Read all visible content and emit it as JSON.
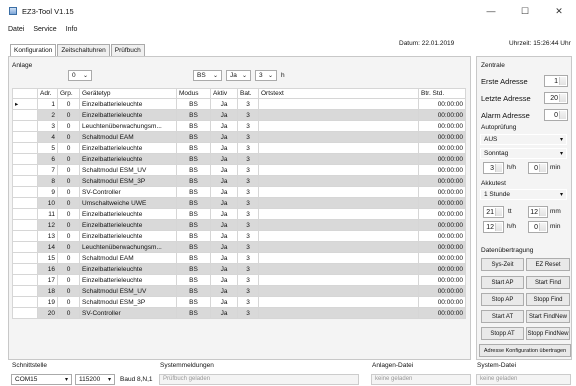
{
  "window": {
    "title": "EZ3-Tool V1.15",
    "minimize": "—",
    "maximize": "☐",
    "close": "✕"
  },
  "menu": [
    "Datei",
    "Service",
    "Info"
  ],
  "tabs": [
    "Konfiguration",
    "Zeitschaltuhren",
    "Prüfbuch"
  ],
  "date_label": "Datum: 22.01.2019",
  "time_label": "Uhrzeit: 15:26:44 Uhr",
  "anlage": {
    "label": "Anlage",
    "value": "0",
    "modus": "BS",
    "aktiv": "Ja",
    "bat": "3",
    "unit": "h"
  },
  "table": {
    "headers": [
      "",
      "Adr.",
      "Grp.",
      "Gerätetyp",
      "Modus",
      "Aktiv",
      "Bat.",
      "Ortstext",
      "Btr. Std."
    ],
    "rows": [
      [
        "▸",
        "1",
        "0",
        "Einzelbatterieleuchte",
        "BS",
        "Ja",
        "3",
        "",
        "00:00:00"
      ],
      [
        "",
        "2",
        "0",
        "Einzelbatterieleuchte",
        "BS",
        "Ja",
        "3",
        "",
        "00:00:00"
      ],
      [
        "",
        "3",
        "0",
        "Leuchtenüberwachungsm...",
        "BS",
        "Ja",
        "3",
        "",
        "00:00:00"
      ],
      [
        "",
        "4",
        "0",
        "Schaltmodul EAM",
        "BS",
        "Ja",
        "3",
        "",
        "00:00:00"
      ],
      [
        "",
        "5",
        "0",
        "Einzelbatterieleuchte",
        "BS",
        "Ja",
        "3",
        "",
        "00:00:00"
      ],
      [
        "",
        "6",
        "0",
        "Einzelbatterieleuchte",
        "BS",
        "Ja",
        "3",
        "",
        "00:00:00"
      ],
      [
        "",
        "7",
        "0",
        "Schaltmodul ESM_UV",
        "BS",
        "Ja",
        "3",
        "",
        "00:00:00"
      ],
      [
        "",
        "8",
        "0",
        "Schaltmodul ESM_3P",
        "BS",
        "Ja",
        "3",
        "",
        "00:00:00"
      ],
      [
        "",
        "9",
        "0",
        "SV-Controller",
        "BS",
        "Ja",
        "3",
        "",
        "00:00:00"
      ],
      [
        "",
        "10",
        "0",
        "Umschaltweiche UWE",
        "BS",
        "Ja",
        "3",
        "",
        "00:00:00"
      ],
      [
        "",
        "11",
        "0",
        "Einzelbatterieleuchte",
        "BS",
        "Ja",
        "3",
        "",
        "00:00:00"
      ],
      [
        "",
        "12",
        "0",
        "Einzelbatterieleuchte",
        "BS",
        "Ja",
        "3",
        "",
        "00:00:00"
      ],
      [
        "",
        "13",
        "0",
        "Einzelbatterieleuchte",
        "BS",
        "Ja",
        "3",
        "",
        "00:00:00"
      ],
      [
        "",
        "14",
        "0",
        "Leuchtenüberwachungsm...",
        "BS",
        "Ja",
        "3",
        "",
        "00:00:00"
      ],
      [
        "",
        "15",
        "0",
        "Schaltmodul EAM",
        "BS",
        "Ja",
        "3",
        "",
        "00:00:00"
      ],
      [
        "",
        "16",
        "0",
        "Einzelbatterieleuchte",
        "BS",
        "Ja",
        "3",
        "",
        "00:00:00"
      ],
      [
        "",
        "17",
        "0",
        "Einzelbatterieleuchte",
        "BS",
        "Ja",
        "3",
        "",
        "00:00:00"
      ],
      [
        "",
        "18",
        "0",
        "Schaltmodul ESM_UV",
        "BS",
        "Ja",
        "3",
        "",
        "00:00:00"
      ],
      [
        "",
        "19",
        "0",
        "Schaltmodul ESM_3P",
        "BS",
        "Ja",
        "3",
        "",
        "00:00:00"
      ],
      [
        "",
        "20",
        "0",
        "SV-Controller",
        "BS",
        "Ja",
        "3",
        "",
        "00:00:00"
      ]
    ]
  },
  "zentrale": {
    "title": "Zentrale",
    "erste_adresse_label": "Erste Adresse",
    "erste_adresse": "1",
    "letzte_adresse_label": "Letzte Adresse",
    "letzte_adresse": "20",
    "alarm_adresse_label": "Alarm Adresse",
    "alarm_adresse": "0",
    "autoprufung_label": "Autoprüfung",
    "autoprufung_value": "AUS",
    "day_value": "Sonntag",
    "hour1": "3",
    "hour1_unit": "h/h",
    "min1": "0",
    "min1_unit": "min",
    "akkutest_label": "Akkutest",
    "akkutest_value": "1 Stunde",
    "day2": "21",
    "day2_unit": "tt",
    "month2": "12",
    "month2_unit": "mm",
    "hour2": "12",
    "hour2_unit": "h/h",
    "min2": "0",
    "min2_unit": "min",
    "datenubertragung_label": "Datenübertragung",
    "buttons": [
      "Sys-Zeit",
      "EZ Reset",
      "Start AP",
      "Start Find",
      "Stop AP",
      "Stopp Find",
      "Start AT",
      "Start FindNew",
      "Stopp AT",
      "Stopp FindNew"
    ],
    "transfer_button": "Adresse Konfiguration übertragen"
  },
  "bottom": {
    "schnittstelle_label": "Schnittstelle",
    "port": "COM15",
    "baud_value": "115200",
    "baud_label": "Baud 8,N,1",
    "systemmeldungen_label": "Systemmeldungen",
    "systemmeldungen_value": "Prüfbuch geladen",
    "anlagen_datei_label": "Anlagen-Datei",
    "anlagen_datei_value": "keine geladen",
    "system_datei_label": "System-Datei",
    "system_datei_value": "keine geladen"
  }
}
